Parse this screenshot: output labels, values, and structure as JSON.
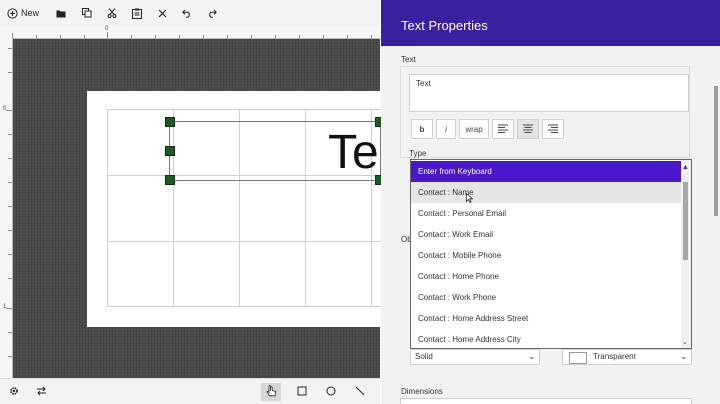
{
  "toolbar": {
    "new_label": "New"
  },
  "rulers": {
    "top_zero": "0",
    "left_zero": "0",
    "left_one": "1"
  },
  "canvas": {
    "textbox_text": "Te"
  },
  "panel": {
    "title": "Text Properties",
    "text_section_label": "Text",
    "text_value": "Text",
    "format_buttons": {
      "bold": "b",
      "italic": "i",
      "wrap": "wrap"
    },
    "type_label": "Type",
    "type_options": [
      "Enter from Keyboard",
      "Contact : Name",
      "Contact : Personal Email",
      "Contact : Work Email",
      "Contact : Mobile Phone",
      "Contact : Home Phone",
      "Contact : Work Phone",
      "Contact : Home Address Street",
      "Contact : Home Address City"
    ],
    "obscured_label": "Ob",
    "border_style": "Solid",
    "fill_color": "Transparent",
    "dimensions_label": "Dimensions"
  },
  "colors": {
    "accent": "#3a1fa0",
    "selection": "#4a18c8",
    "handle": "#1e5a1e",
    "canvas_bg": "#4a4a4a"
  },
  "icons": {
    "toolbar": [
      "plus-circle-icon",
      "folder-icon",
      "copy-icon",
      "cut-icon",
      "paste-icon",
      "delete-icon",
      "undo-icon",
      "redo-icon"
    ],
    "bottom": [
      "gear-icon",
      "swap-icon",
      "pointer-icon",
      "rectangle-icon",
      "ellipse-icon",
      "line-icon"
    ]
  }
}
